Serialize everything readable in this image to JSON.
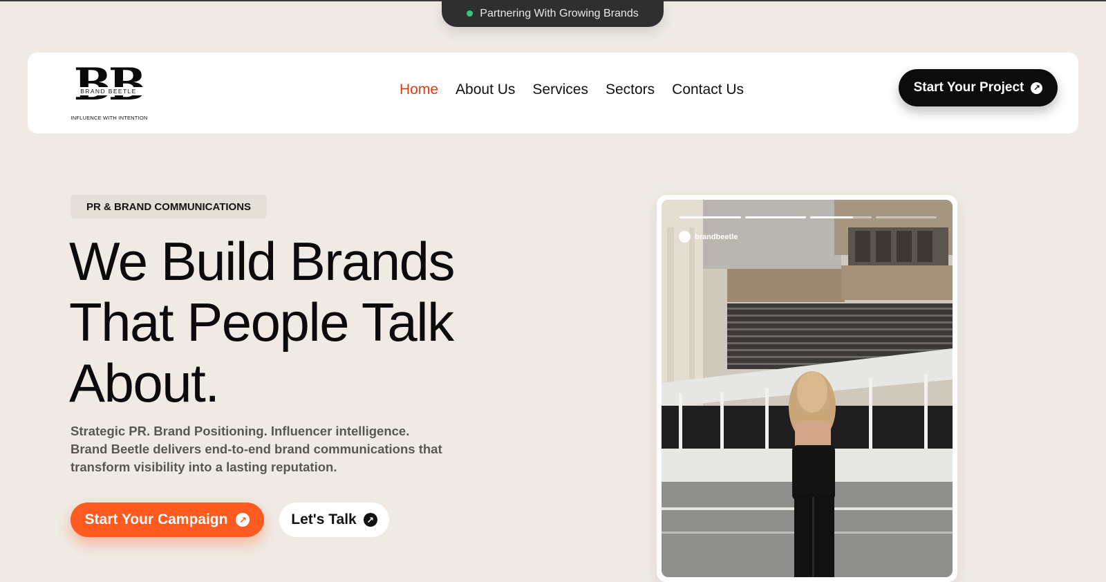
{
  "banner": {
    "text": "Partnering With Growing Brands",
    "status_color": "#34c776"
  },
  "logo": {
    "monogram": "BB",
    "name": "BRAND BEETLE",
    "tagline": "INFLUENCE WITH INTENTION"
  },
  "nav": {
    "items": [
      {
        "label": "Home",
        "active": true
      },
      {
        "label": "About Us",
        "active": false
      },
      {
        "label": "Services",
        "active": false
      },
      {
        "label": "Sectors",
        "active": false
      },
      {
        "label": "Contact Us",
        "active": false
      }
    ],
    "cta_label": "Start Your Project",
    "cta_icon": "arrow-up-right-icon"
  },
  "hero": {
    "eyebrow": "PR & BRAND COMMUNICATIONS",
    "title_lines": [
      "We Build Brands",
      "That People Talk",
      "About."
    ],
    "description_lines": [
      "Strategic PR. Brand Positioning. Influencer intelligence.",
      "Brand Beetle delivers end-to-end brand communications that",
      "transform visibility into a lasting reputation."
    ],
    "primary_button": "Start Your Campaign",
    "secondary_button": "Let's Talk"
  },
  "story": {
    "handle": "brandbeetle",
    "progress": [
      1,
      1,
      0.7,
      0
    ]
  },
  "colors": {
    "accent": "#ff5a1f",
    "nav_active": "#e33a10",
    "background": "#efebe4",
    "dark": "#0c0c0c"
  }
}
